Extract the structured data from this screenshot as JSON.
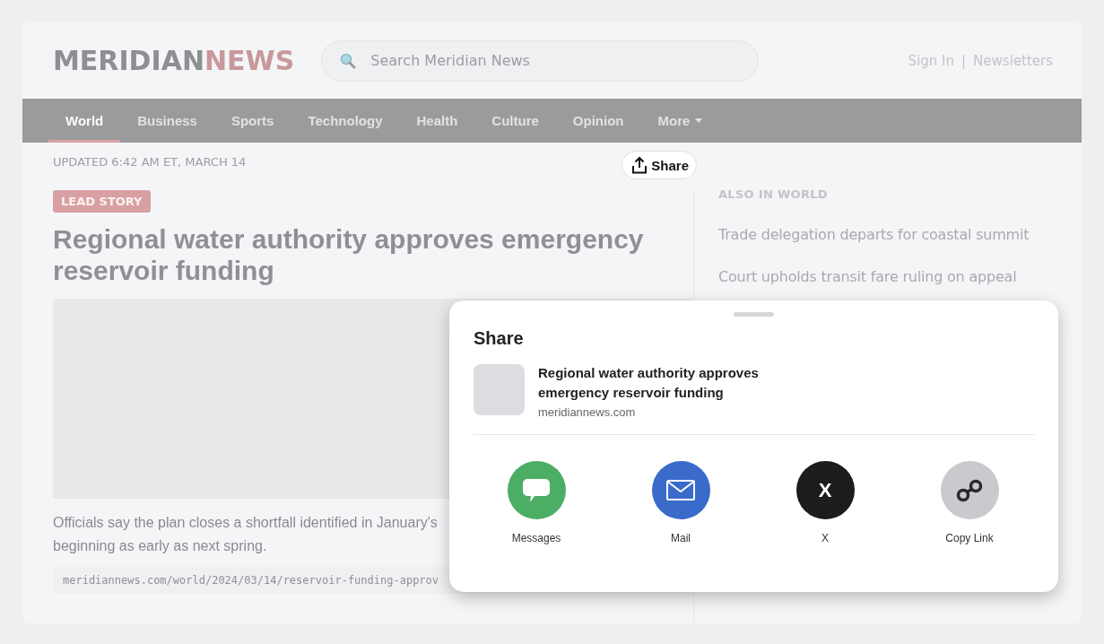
{
  "header": {
    "logo_parts": [
      "MERIDIAN",
      "NEWS"
    ],
    "search": {
      "placeholder": "Search Meridian News"
    },
    "account_links": [
      "Sign In",
      "Newsletters"
    ],
    "separator": "|"
  },
  "nav": [
    {
      "label": "World",
      "selected": true,
      "kind": "link"
    },
    {
      "label": "Business",
      "selected": false,
      "kind": "link"
    },
    {
      "label": "Sports",
      "selected": false,
      "kind": "link"
    },
    {
      "label": "Technology",
      "selected": false,
      "kind": "link"
    },
    {
      "label": "Health",
      "selected": false,
      "kind": "link"
    },
    {
      "label": "Culture",
      "selected": false,
      "kind": "link"
    },
    {
      "label": "Opinion",
      "selected": false,
      "kind": "link"
    },
    {
      "label": "More",
      "selected": false,
      "kind": "menu"
    }
  ],
  "article": {
    "updated": "UPDATED 6:42 AM ET, MARCH 14",
    "share_button": "Share",
    "tag": "LEAD STORY",
    "headline": "Regional water authority approves emergency reservoir funding",
    "summary_lines": [
      "Officials say the plan closes a shortfall identified in January's",
      "beginning as early as next spring."
    ],
    "url": "meridiannews.com/world/2024/03/14/reservoir-funding-approv"
  },
  "sidebar": {
    "heading": "ALSO IN WORLD",
    "items": [
      "Trade delegation departs for coastal summit",
      "Court upholds transit fare ruling on appeal"
    ]
  },
  "share_sheet": {
    "title": "Share",
    "preview": {
      "title": "Regional water authority approves emergency reservoir funding",
      "domain": "meridiannews.com"
    },
    "targets": [
      {
        "label": "Messages",
        "kind": "messages",
        "color": "#4cae64"
      },
      {
        "label": "Mail",
        "kind": "mail",
        "color": "#3a6bcb"
      },
      {
        "label": "X",
        "kind": "x",
        "color": "#1c1c1e",
        "glyph": "X"
      },
      {
        "label": "Copy Link",
        "kind": "link",
        "color": "#c9cacd"
      }
    ]
  }
}
